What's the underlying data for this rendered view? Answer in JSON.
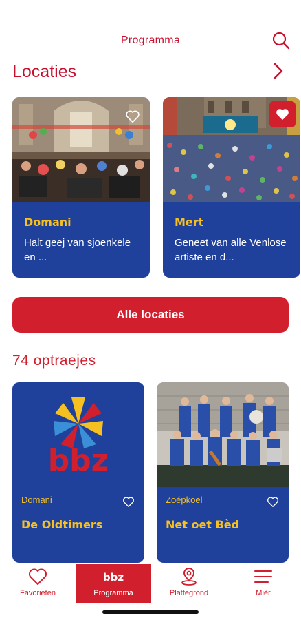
{
  "header": {
    "title": "Programma"
  },
  "locations": {
    "title": "Locaties",
    "cards": [
      {
        "name": "Domani",
        "description": "Halt geej van sjoenkele en ...",
        "favorite": false
      },
      {
        "name": "Mert",
        "description": "Geneet van alle Venlose artiste en d...",
        "favorite": true
      }
    ],
    "all_button": "Alle locaties"
  },
  "acts": {
    "title": "74 optraejes",
    "cards": [
      {
        "location": "Domani",
        "name": "De Oldtimers"
      },
      {
        "location": "Zoépkoel",
        "name": "Net oet Bèd"
      }
    ]
  },
  "tabbar": {
    "items": [
      {
        "label": "Favorieten",
        "icon": "heart-icon"
      },
      {
        "label": "Programma",
        "icon": "bbz-logo-icon",
        "active": true
      },
      {
        "label": "Plattegrond",
        "icon": "map-pin-icon"
      },
      {
        "label": "Mièr",
        "icon": "menu-icon"
      }
    ]
  },
  "colors": {
    "accent": "#d11f2e",
    "card": "#1f419b",
    "highlight": "#f5c020"
  }
}
